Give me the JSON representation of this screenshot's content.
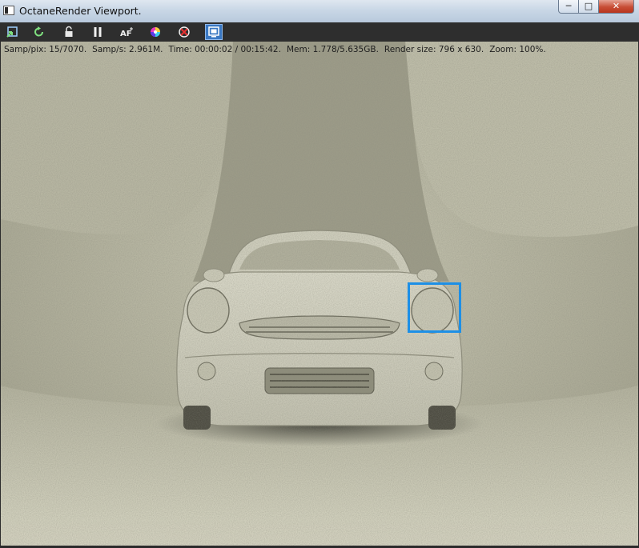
{
  "window": {
    "title": "OctaneRender Viewport.",
    "controls": {
      "minimize": "─",
      "maximize": "□",
      "close": "✕"
    }
  },
  "toolbar": {
    "buttons": [
      {
        "name": "send-to-viewport-icon",
        "glyph": "⇱"
      },
      {
        "name": "refresh-icon",
        "glyph": "↻"
      },
      {
        "name": "lock-icon",
        "glyph": "🔒"
      },
      {
        "name": "pause-icon",
        "glyph": "❚❚"
      },
      {
        "name": "autofocus-icon",
        "glyph": "AF"
      },
      {
        "name": "color-picker-icon",
        "glyph": "◉"
      },
      {
        "name": "no-render-icon",
        "glyph": "✖"
      },
      {
        "name": "region-render-icon",
        "glyph": "▣"
      }
    ]
  },
  "status": {
    "samp_pix": "Samp/pix: 15/7070.",
    "samp_s": "Samp/s: 2.961M.",
    "time": "Time: 00:00:02 / 00:15:42.",
    "mem": "Mem: 1.778/5.635GB.",
    "render_size": "Render size: 796 x 630.",
    "zoom": "Zoom: 100%."
  },
  "colors": {
    "background": "#b8b7a3",
    "floor": "#d2d1be",
    "car_body": "#d9d8c8",
    "selection": "#1d8fe6"
  }
}
